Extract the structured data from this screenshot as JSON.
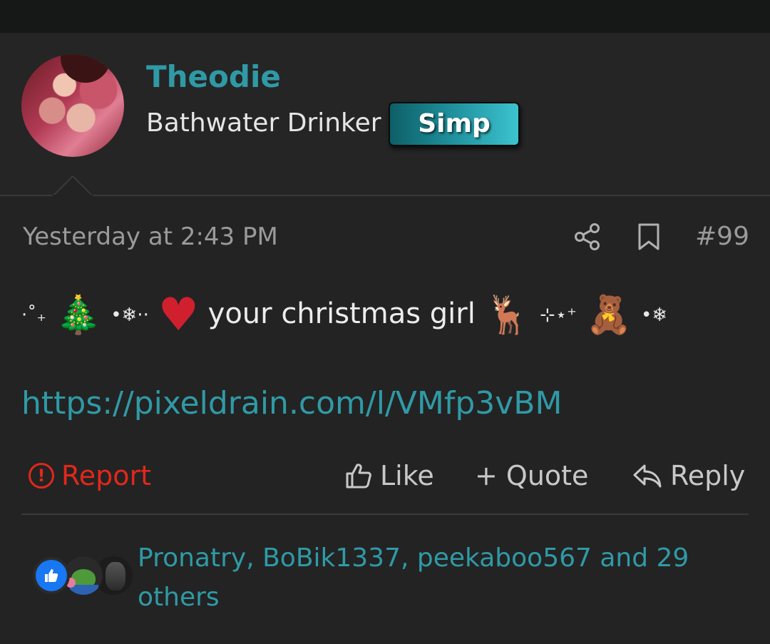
{
  "post": {
    "username": "Theodie",
    "user_title": "Bathwater Drinker",
    "user_banner": "Simp",
    "timestamp": "Yesterday at 2:43 PM",
    "post_number": "#99",
    "message": {
      "prefix_deco": "·˚₊",
      "deco_snow1": "•❄︎··",
      "text": "your christmas girl",
      "deco_sparkle": "⊹⋆⁺",
      "deco_snow2": "•❄︎"
    },
    "link": "https://pixeldrain.com/l/VMfp3vBM"
  },
  "actions": {
    "report": "Report",
    "like": "Like",
    "quote": "+ Quote",
    "reply": "Reply"
  },
  "reactions": {
    "names_text": "Pronatry, BoBik1337, peekaboo567 and 29 others"
  },
  "colors": {
    "background": "#232323",
    "username": "#2f9aa6",
    "link": "#2f9aa6",
    "report": "#e0281b",
    "banner": "#1d8d99"
  },
  "icons": [
    "share-icon",
    "bookmark-icon",
    "report-icon",
    "thumbs-up-icon",
    "reply-arrow-icon",
    "like-reaction-icon"
  ]
}
